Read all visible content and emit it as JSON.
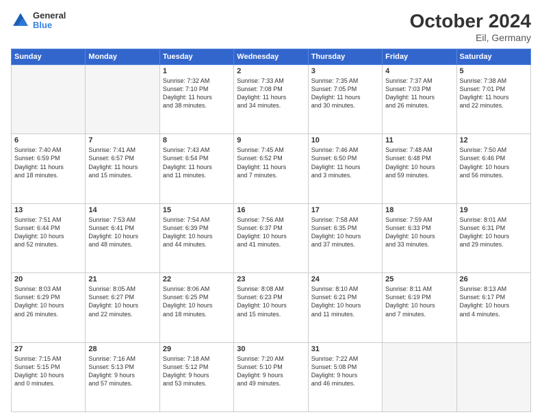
{
  "header": {
    "logo_line1": "General",
    "logo_line2": "Blue",
    "month_title": "October 2024",
    "subtitle": "Eil, Germany"
  },
  "weekdays": [
    "Sunday",
    "Monday",
    "Tuesday",
    "Wednesday",
    "Thursday",
    "Friday",
    "Saturday"
  ],
  "weeks": [
    [
      {
        "day": "",
        "info": ""
      },
      {
        "day": "",
        "info": ""
      },
      {
        "day": "1",
        "info": "Sunrise: 7:32 AM\nSunset: 7:10 PM\nDaylight: 11 hours\nand 38 minutes."
      },
      {
        "day": "2",
        "info": "Sunrise: 7:33 AM\nSunset: 7:08 PM\nDaylight: 11 hours\nand 34 minutes."
      },
      {
        "day": "3",
        "info": "Sunrise: 7:35 AM\nSunset: 7:05 PM\nDaylight: 11 hours\nand 30 minutes."
      },
      {
        "day": "4",
        "info": "Sunrise: 7:37 AM\nSunset: 7:03 PM\nDaylight: 11 hours\nand 26 minutes."
      },
      {
        "day": "5",
        "info": "Sunrise: 7:38 AM\nSunset: 7:01 PM\nDaylight: 11 hours\nand 22 minutes."
      }
    ],
    [
      {
        "day": "6",
        "info": "Sunrise: 7:40 AM\nSunset: 6:59 PM\nDaylight: 11 hours\nand 18 minutes."
      },
      {
        "day": "7",
        "info": "Sunrise: 7:41 AM\nSunset: 6:57 PM\nDaylight: 11 hours\nand 15 minutes."
      },
      {
        "day": "8",
        "info": "Sunrise: 7:43 AM\nSunset: 6:54 PM\nDaylight: 11 hours\nand 11 minutes."
      },
      {
        "day": "9",
        "info": "Sunrise: 7:45 AM\nSunset: 6:52 PM\nDaylight: 11 hours\nand 7 minutes."
      },
      {
        "day": "10",
        "info": "Sunrise: 7:46 AM\nSunset: 6:50 PM\nDaylight: 11 hours\nand 3 minutes."
      },
      {
        "day": "11",
        "info": "Sunrise: 7:48 AM\nSunset: 6:48 PM\nDaylight: 10 hours\nand 59 minutes."
      },
      {
        "day": "12",
        "info": "Sunrise: 7:50 AM\nSunset: 6:46 PM\nDaylight: 10 hours\nand 56 minutes."
      }
    ],
    [
      {
        "day": "13",
        "info": "Sunrise: 7:51 AM\nSunset: 6:44 PM\nDaylight: 10 hours\nand 52 minutes."
      },
      {
        "day": "14",
        "info": "Sunrise: 7:53 AM\nSunset: 6:41 PM\nDaylight: 10 hours\nand 48 minutes."
      },
      {
        "day": "15",
        "info": "Sunrise: 7:54 AM\nSunset: 6:39 PM\nDaylight: 10 hours\nand 44 minutes."
      },
      {
        "day": "16",
        "info": "Sunrise: 7:56 AM\nSunset: 6:37 PM\nDaylight: 10 hours\nand 41 minutes."
      },
      {
        "day": "17",
        "info": "Sunrise: 7:58 AM\nSunset: 6:35 PM\nDaylight: 10 hours\nand 37 minutes."
      },
      {
        "day": "18",
        "info": "Sunrise: 7:59 AM\nSunset: 6:33 PM\nDaylight: 10 hours\nand 33 minutes."
      },
      {
        "day": "19",
        "info": "Sunrise: 8:01 AM\nSunset: 6:31 PM\nDaylight: 10 hours\nand 29 minutes."
      }
    ],
    [
      {
        "day": "20",
        "info": "Sunrise: 8:03 AM\nSunset: 6:29 PM\nDaylight: 10 hours\nand 26 minutes."
      },
      {
        "day": "21",
        "info": "Sunrise: 8:05 AM\nSunset: 6:27 PM\nDaylight: 10 hours\nand 22 minutes."
      },
      {
        "day": "22",
        "info": "Sunrise: 8:06 AM\nSunset: 6:25 PM\nDaylight: 10 hours\nand 18 minutes."
      },
      {
        "day": "23",
        "info": "Sunrise: 8:08 AM\nSunset: 6:23 PM\nDaylight: 10 hours\nand 15 minutes."
      },
      {
        "day": "24",
        "info": "Sunrise: 8:10 AM\nSunset: 6:21 PM\nDaylight: 10 hours\nand 11 minutes."
      },
      {
        "day": "25",
        "info": "Sunrise: 8:11 AM\nSunset: 6:19 PM\nDaylight: 10 hours\nand 7 minutes."
      },
      {
        "day": "26",
        "info": "Sunrise: 8:13 AM\nSunset: 6:17 PM\nDaylight: 10 hours\nand 4 minutes."
      }
    ],
    [
      {
        "day": "27",
        "info": "Sunrise: 7:15 AM\nSunset: 5:15 PM\nDaylight: 10 hours\nand 0 minutes."
      },
      {
        "day": "28",
        "info": "Sunrise: 7:16 AM\nSunset: 5:13 PM\nDaylight: 9 hours\nand 57 minutes."
      },
      {
        "day": "29",
        "info": "Sunrise: 7:18 AM\nSunset: 5:12 PM\nDaylight: 9 hours\nand 53 minutes."
      },
      {
        "day": "30",
        "info": "Sunrise: 7:20 AM\nSunset: 5:10 PM\nDaylight: 9 hours\nand 49 minutes."
      },
      {
        "day": "31",
        "info": "Sunrise: 7:22 AM\nSunset: 5:08 PM\nDaylight: 9 hours\nand 46 minutes."
      },
      {
        "day": "",
        "info": ""
      },
      {
        "day": "",
        "info": ""
      }
    ]
  ]
}
